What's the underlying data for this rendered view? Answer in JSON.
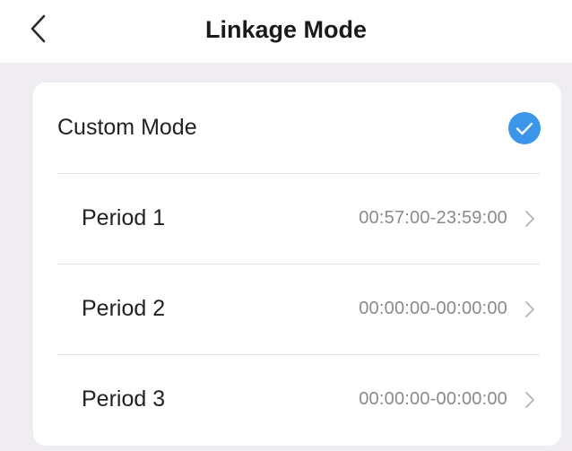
{
  "header": {
    "title": "Linkage Mode",
    "back_icon": "chevron-left-icon"
  },
  "custom_mode": {
    "label": "Custom Mode",
    "selected": true,
    "check_icon": "check-circle-icon",
    "accent_color": "#3b95e9"
  },
  "periods": [
    {
      "label": "Period 1",
      "value": "00:57:00-23:59:00"
    },
    {
      "label": "Period 2",
      "value": "00:00:00-00:00:00"
    },
    {
      "label": "Period 3",
      "value": "00:00:00-00:00:00"
    }
  ],
  "colors": {
    "background": "#efedf2",
    "card": "#ffffff",
    "divider": "#e3e3e6",
    "secondary_text": "#8a8a8a"
  }
}
